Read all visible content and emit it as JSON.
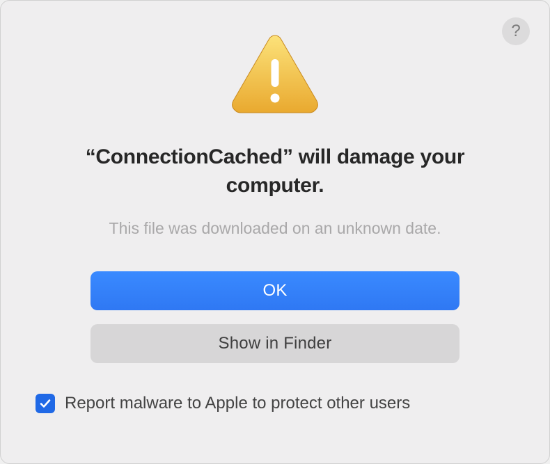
{
  "dialog": {
    "help_label": "?",
    "title": "“ConnectionCached” will damage your computer.",
    "subtitle": "This file was downloaded on an unknown date.",
    "buttons": {
      "primary": "OK",
      "secondary": "Show in Finder"
    },
    "checkbox": {
      "checked": true,
      "label": "Report malware to Apple to protect other users"
    }
  },
  "icons": {
    "warning": "warning-triangle-icon",
    "help": "help-icon",
    "checkmark": "checkmark-icon"
  },
  "colors": {
    "primary_button": "#3a8aff",
    "checkbox_bg": "#2069e6",
    "dialog_bg": "#efeeef"
  }
}
